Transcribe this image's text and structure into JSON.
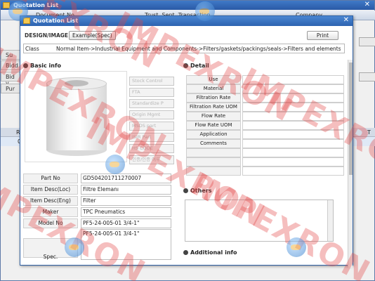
{
  "outer": {
    "title": "Quotation List",
    "columns": [
      "Document No",
      "Trust. Sent. Transaction",
      "Company"
    ],
    "side_labels": [
      "Su",
      "Bidd",
      "Bid v",
      "Pur"
    ],
    "grid_first_col": "R",
    "grid_first_value": "0",
    "grid_right_header": "T"
  },
  "modal": {
    "title": "Quotation List",
    "toolbar": {
      "design_label": "DESIGN/IMAGE",
      "example_button": "Example(Spec)",
      "print_button": "Print"
    },
    "class": {
      "label": "Class",
      "value": "Normal Item->Industrial Equipment and Components->Filters/gaskets/packings/seals->Filters and elements-"
    },
    "basic_info": {
      "heading": "Basic info",
      "side_buttons": [
        "Stock Control",
        "FTA",
        "Standardize P",
        "Origin Mgmt",
        "MSDS part",
        "ISIR Part",
        "HS CODE",
        "인증/인증 여부"
      ],
      "fields": [
        {
          "label": "Part No",
          "value": "GD504201711270007"
        },
        {
          "label": "Item Desc(Loc)",
          "value": "Filtre Elemanı"
        },
        {
          "label": "Item Desc(Eng)",
          "value": "Filter"
        },
        {
          "label": "Maker",
          "value": "TPC Pneumatics"
        },
        {
          "label": "Model No",
          "value": "PF5-24-005-01  3/4-1\""
        }
      ],
      "spec_label": "Spec.",
      "spec_value": "PF5-24-005-01  3/4-1\""
    },
    "detail": {
      "heading": "Detail",
      "rows": [
        "Use",
        "Material",
        "Filtration Rate",
        "Filtration Rate UOM",
        "Flow Rate",
        "Flow Rate UOM",
        "Application",
        "Comments",
        "",
        "",
        ""
      ]
    },
    "others": {
      "heading": "Others"
    },
    "additional": {
      "heading": "Additional info"
    }
  },
  "watermark": "IMPEXRON"
}
